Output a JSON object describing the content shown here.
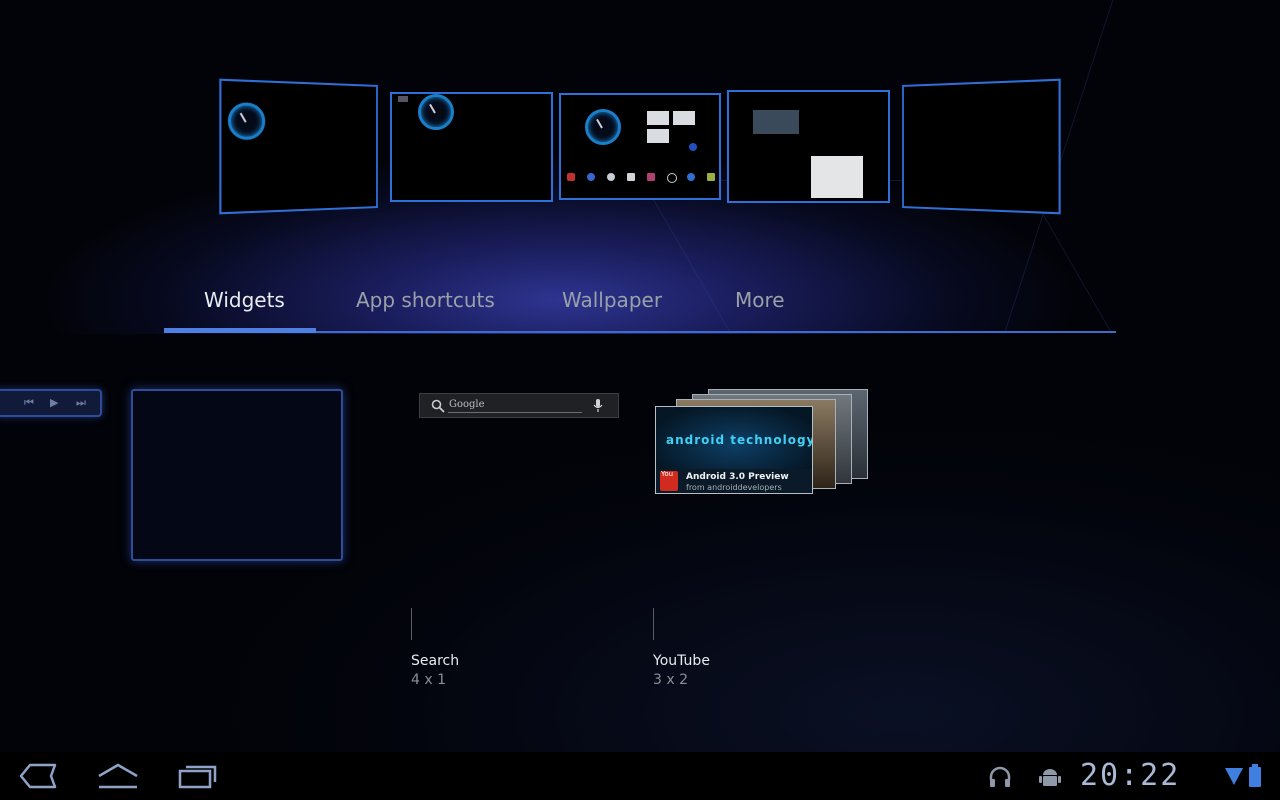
{
  "workspaces": {
    "count": 5,
    "active_index": 2
  },
  "tabs": [
    {
      "label": "Widgets",
      "active": true
    },
    {
      "label": "App shortcuts",
      "active": false
    },
    {
      "label": "Wallpaper",
      "active": false
    },
    {
      "label": "More",
      "active": false
    }
  ],
  "widget_preview": {
    "search_placeholder": "Google",
    "youtube_card": {
      "brand": "android technology",
      "title": "Android 3.0 Preview",
      "subtitle": "from androiddevelopers"
    }
  },
  "widgets": [
    {
      "name": "Search",
      "size": "4 x 1"
    },
    {
      "name": "YouTube",
      "size": "3 x 2"
    }
  ],
  "status_bar": {
    "time": "20:22"
  },
  "icons": {
    "back": "back-icon",
    "home": "home-icon",
    "recents": "recents-icon",
    "headphones": "headphones-icon",
    "debug": "android-debug-icon",
    "wifi": "wifi-signal-icon",
    "battery": "battery-icon"
  },
  "colors": {
    "accent": "#4f7fe0",
    "workspace_border": "#2e6fd8"
  }
}
